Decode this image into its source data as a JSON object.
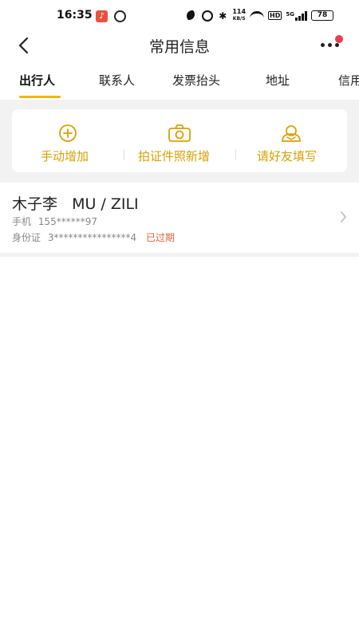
{
  "status_bar": {
    "time": "16:35",
    "net_speed_value": "114",
    "net_speed_unit": "KB/S",
    "hd_label": "HD",
    "signal_label": "5G",
    "battery": "78"
  },
  "header": {
    "title": "常用信息"
  },
  "tabs": [
    {
      "label": "出行人",
      "active": true
    },
    {
      "label": "联系人",
      "active": false
    },
    {
      "label": "发票抬头",
      "active": false
    },
    {
      "label": "地址",
      "active": false
    },
    {
      "label": "信用",
      "active": false
    }
  ],
  "actions": [
    {
      "label": "手动增加",
      "icon": "plus-circle-icon"
    },
    {
      "label": "拍证件照新增",
      "icon": "camera-icon"
    },
    {
      "label": "请好友填写",
      "icon": "friend-icon"
    }
  ],
  "traveler": {
    "name": "木子李",
    "pinyin": "MU / ZILI",
    "phone_label": "手机",
    "phone": "155******97",
    "id_label": "身份证",
    "id_number": "3****************4",
    "status": "已过期"
  },
  "colors": {
    "accent": "#f2b705",
    "action_text": "#d9a106",
    "expired": "#e0623a",
    "notification": "#ec3c4a"
  }
}
